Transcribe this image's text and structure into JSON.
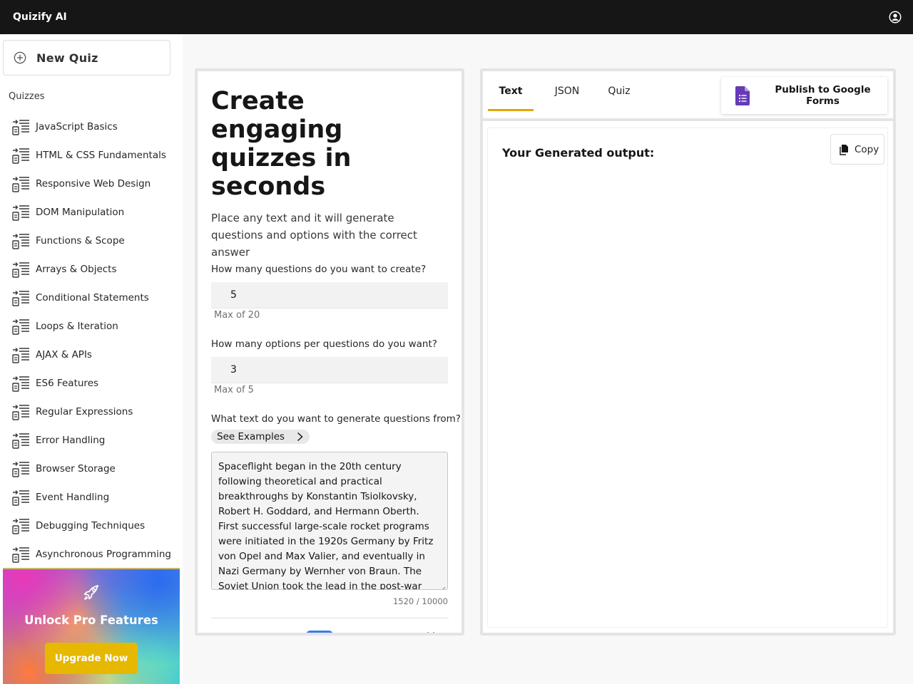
{
  "header": {
    "brand": "Quizify AI",
    "user_icon": "user-avatar-icon"
  },
  "sidebar": {
    "new_quiz_label": "New Quiz",
    "section_title": "Quizzes",
    "items": [
      {
        "label": "JavaScript Basics"
      },
      {
        "label": "HTML & CSS Fundamentals"
      },
      {
        "label": "Responsive Web Design"
      },
      {
        "label": "DOM Manipulation"
      },
      {
        "label": "Functions & Scope"
      },
      {
        "label": "Arrays & Objects"
      },
      {
        "label": "Conditional Statements"
      },
      {
        "label": "Loops & Iteration"
      },
      {
        "label": "AJAX & APIs"
      },
      {
        "label": "ES6 Features"
      },
      {
        "label": "Regular Expressions"
      },
      {
        "label": "Error Handling"
      },
      {
        "label": "Browser Storage"
      },
      {
        "label": "Event Handling"
      },
      {
        "label": "Debugging Techniques"
      },
      {
        "label": "Asynchronous Programming"
      }
    ],
    "promo": {
      "title": "Unlock Pro Features",
      "button": "Upgrade Now"
    }
  },
  "form": {
    "heading": "Create engaging quizzes in seconds",
    "subheading": "Place any text and it will generate questions and options with the correct answer",
    "questions": {
      "label": "How many questions do you want to create?",
      "value": "5",
      "helper": "Max of 20"
    },
    "options": {
      "label": "How many options per questions do you want?",
      "value": "3",
      "helper": "Max of 5"
    },
    "source": {
      "label": "What text do you want to generate questions from?",
      "examples_label": "See Examples",
      "text": "Spaceflight began in the 20th century following theoretical and practical breakthroughs by Konstantin Tsiolkovsky, Robert H. Goddard, and Hermann Oberth. First successful large-scale rocket programs were initiated in the 1920s Germany by Fritz von Opel and Max Valier, and eventually in Nazi Germany by Wernher von Braun. The Soviet Union took the lead in the post-war Space Race, launching the first",
      "counter": "1520 / 10000"
    }
  },
  "output": {
    "tabs": [
      {
        "label": "Text",
        "active": true
      },
      {
        "label": "JSON",
        "active": false
      },
      {
        "label": "Quiz",
        "active": false
      }
    ],
    "publish_label": "Publish to Google Forms",
    "title": "Your Generated output:",
    "copy_label": "Copy"
  },
  "colors": {
    "topbar": "#161616",
    "accent": "#e0a800",
    "upgrade_button": "#e6b800",
    "forms_purple": "#673ab7",
    "toggle_blue": "#3b7de0"
  }
}
